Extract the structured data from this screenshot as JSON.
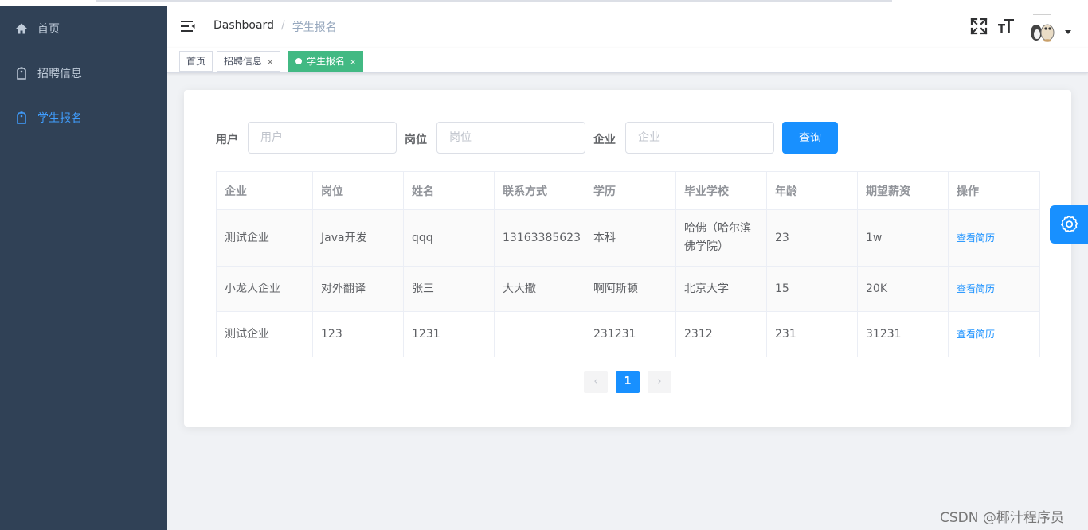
{
  "sidebar": {
    "items": [
      {
        "label": "首页",
        "icon": "home-icon"
      },
      {
        "label": "招聘信息",
        "icon": "tag-icon"
      },
      {
        "label": "学生报名",
        "icon": "tag-icon"
      }
    ],
    "bg_color": "#304156",
    "active_color": "#409eff"
  },
  "navbar": {
    "breadcrumb": {
      "home": "Dashboard",
      "separator": "/",
      "current": "学生报名"
    },
    "icons": [
      "menu-fold-icon",
      "fullscreen-icon",
      "font-size-icon",
      "avatar",
      "caret-down-icon"
    ]
  },
  "tags": [
    {
      "label": "首页"
    },
    {
      "label": "招聘信息",
      "close": "×"
    },
    {
      "label": "学生报名",
      "close": "×",
      "active": true
    }
  ],
  "search": {
    "user_label": "用户",
    "user_placeholder": "用户",
    "position_label": "岗位",
    "position_placeholder": "岗位",
    "company_label": "企业",
    "company_placeholder": "企业",
    "query_button": "查询"
  },
  "table": {
    "headers": [
      "企业",
      "岗位",
      "姓名",
      "联系方式",
      "学历",
      "毕业学校",
      "年龄",
      "期望薪资",
      "操作"
    ],
    "rows": [
      {
        "company": "测试企业",
        "position": "Java开发",
        "name": "qqq",
        "contact": "13163385623",
        "education": "本科",
        "school": "哈佛（哈尔滨佛学院）",
        "age": "23",
        "salary": "1w",
        "action": "查看简历"
      },
      {
        "company": "小龙人企业",
        "position": "对外翻译",
        "name": "张三",
        "contact": "大大撒",
        "education": "啊阿斯顿",
        "school": "北京大学",
        "age": "15",
        "salary": "20K",
        "action": "查看简历"
      },
      {
        "company": "测试企业",
        "position": "123",
        "name": "1231",
        "contact": "",
        "education": "231231",
        "school": "2312",
        "age": "231",
        "salary": "31231",
        "action": "查看简历"
      }
    ]
  },
  "pagination": {
    "prev": "‹",
    "current_page": "1",
    "next": "›"
  },
  "settings": {
    "icon": "gear-icon",
    "color": "#1890ff"
  },
  "watermark": "CSDN @椰汁程序员",
  "colors": {
    "primary": "#1890ff",
    "tag_active": "#42b983",
    "page_bg": "#f0f2f5"
  }
}
